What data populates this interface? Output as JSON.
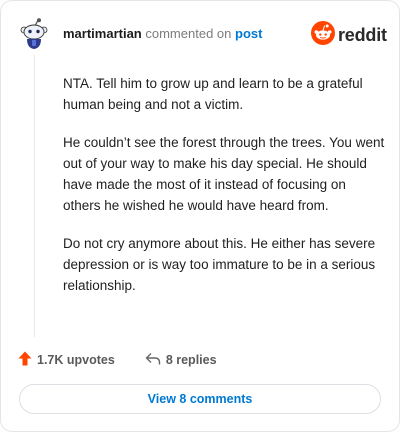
{
  "comment": {
    "username": "martimartian",
    "commented_text": "commented on",
    "post_link": "post",
    "paragraphs": [
      "NTA. Tell him to grow up and learn to be a grateful human being and not a victim.",
      "He couldn’t see the forest through the trees. You went out of your way to make his day special. He should have made the most of it instead of focusing on others he wished he would have heard from.",
      "Do not cry anymore about this. He either has severe depression or is way too immature to be in a serious relationship."
    ]
  },
  "brand": {
    "wordmark": "reddit",
    "color": "#ff4500"
  },
  "actions": {
    "upvotes": "1.7K upvotes",
    "replies": "8 replies"
  },
  "view_button": {
    "label": "View 8 comments"
  },
  "icons": {
    "avatar": "snoo-avatar-icon",
    "logo": "reddit-logo-icon",
    "upvote": "upvote-arrow-icon",
    "reply": "reply-arrow-icon"
  },
  "colors": {
    "link": "#0079d3",
    "upvote": "#ff4500",
    "text": "#1c1c1c"
  }
}
